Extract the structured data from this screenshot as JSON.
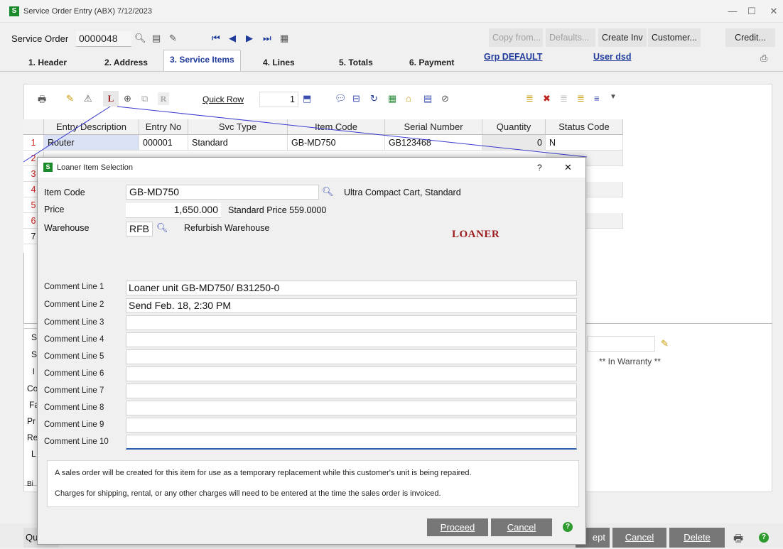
{
  "window": {
    "title": "Service Order Entry (ABX) 7/12/2023"
  },
  "header": {
    "so_label": "Service Order",
    "so_value": "0000048",
    "buttons": {
      "copy_from": "Copy from...",
      "defaults": "Defaults...",
      "create_inv": "Create Inv",
      "customer": "Customer...",
      "credit": "Credit..."
    }
  },
  "tabs": [
    {
      "label": "1. Header"
    },
    {
      "label": "2. Address"
    },
    {
      "label": "3. Service Items"
    },
    {
      "label": "4. Lines"
    },
    {
      "label": "5. Totals"
    },
    {
      "label": "6. Payment"
    }
  ],
  "links": {
    "grp": "Grp DEFAULT",
    "user": "User dsd"
  },
  "toolbar": {
    "quick_row_label": "Quick Row",
    "quick_row_value": "1"
  },
  "grid": {
    "headers": [
      "Entry Description",
      "Entry No",
      "Svc Type",
      "Item Code",
      "Serial Number",
      "Quantity",
      "Status Code"
    ],
    "row_numbers": [
      "1",
      "2",
      "3",
      "4",
      "5",
      "6",
      "7"
    ],
    "rows": [
      {
        "description": "Router",
        "entry_no": "000001",
        "svc_type": "Standard",
        "item_code": "GB-MD750",
        "serial": "GB123468",
        "quantity": "0",
        "status": "N"
      }
    ]
  },
  "side_labels": [
    "S",
    "S",
    "l",
    "Co",
    "Fa",
    "Pr",
    "Re",
    "L",
    "",
    "Bi"
  ],
  "warranty_text": "** In Warranty **",
  "dialog": {
    "title": "Loaner Item Selection",
    "help": "?",
    "close": "✕",
    "item_code_label": "Item Code",
    "item_code": "GB-MD750",
    "item_desc": "Ultra Compact Cart, Standard",
    "price_label": "Price",
    "price": "1,650.000",
    "standard_price": "Standard Price 559.0000",
    "warehouse_label": "Warehouse",
    "warehouse": "RFB",
    "warehouse_desc": "Refurbish Warehouse",
    "stamp": "LOANER",
    "comments": [
      {
        "label": "Comment Line 1",
        "value": "Loaner unit GB-MD750/ B31250-0"
      },
      {
        "label": "Comment Line 2",
        "value": "Send Feb. 18, 2:30 PM"
      },
      {
        "label": "Comment Line 3",
        "value": ""
      },
      {
        "label": "Comment Line 4",
        "value": ""
      },
      {
        "label": "Comment Line 5",
        "value": ""
      },
      {
        "label": "Comment Line 6",
        "value": ""
      },
      {
        "label": "Comment Line 7",
        "value": ""
      },
      {
        "label": "Comment Line 8",
        "value": ""
      },
      {
        "label": "Comment Line 9",
        "value": ""
      },
      {
        "label": "Comment Line 10",
        "value": ""
      }
    ],
    "info1": "A sales order will be created for this item for use as a temporary replacement while this customer's unit is being repaired.",
    "info2": "Charges for shipping, rental, or any other charges will need to be entered at the time the sales order is invoiced.",
    "proceed": "Proceed",
    "cancel": "Cancel"
  },
  "bottom": {
    "quick": "Quic",
    "accept": "ept",
    "cancel": "Cancel",
    "delete": "Delete"
  },
  "colors": {
    "link": "#1f3b9a",
    "stamp": "#9b1c1c",
    "button": "#777777",
    "accent_line": "#3a3ad0",
    "row_number": "#d02020"
  }
}
